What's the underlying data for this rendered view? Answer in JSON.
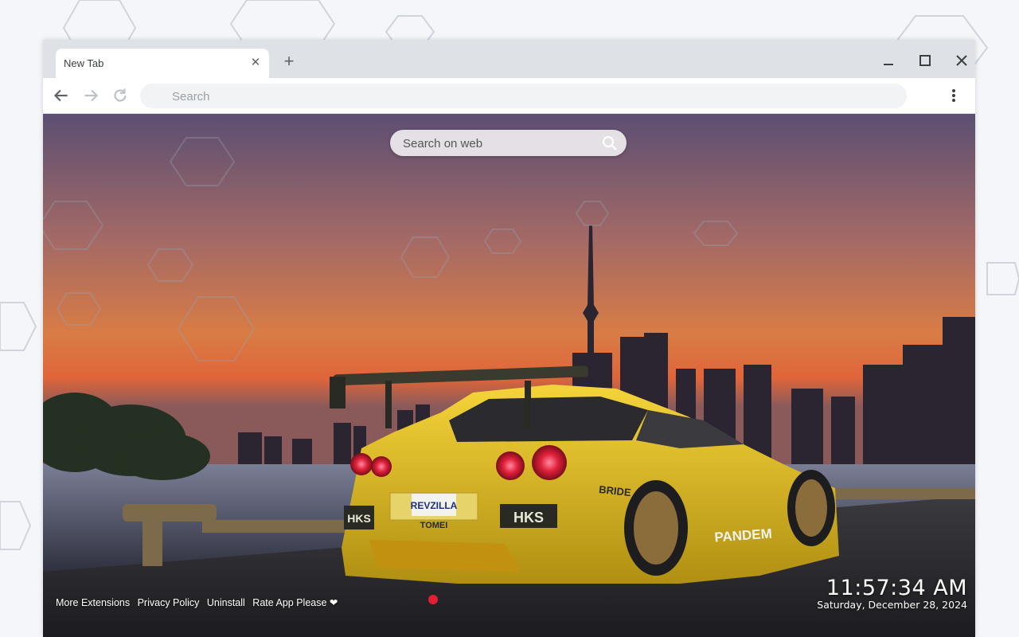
{
  "browser": {
    "tab_title": "New Tab",
    "tab_close": "✕",
    "new_tab": "+",
    "omnibox_placeholder": "Search"
  },
  "newtab_page": {
    "search_placeholder": "Search on web",
    "footer_links": [
      "More Extensions",
      "Privacy Policy",
      "Uninstall",
      "Rate App Please ❤"
    ],
    "clock_time": "11:57:34 AM",
    "clock_date": "Saturday, December 28, 2024"
  },
  "wallpaper": {
    "plates": {
      "rear": "REVZILLA",
      "rear_bar": "TOMEI",
      "left": "HKS",
      "right": "HKS"
    },
    "decals": {
      "side": "BRIDE",
      "door": "PANDEM"
    }
  },
  "colors": {
    "chrome_frame": "#dee1e6",
    "car_yellow": "#e9c21c",
    "sky_orange": "#d97b3c"
  }
}
